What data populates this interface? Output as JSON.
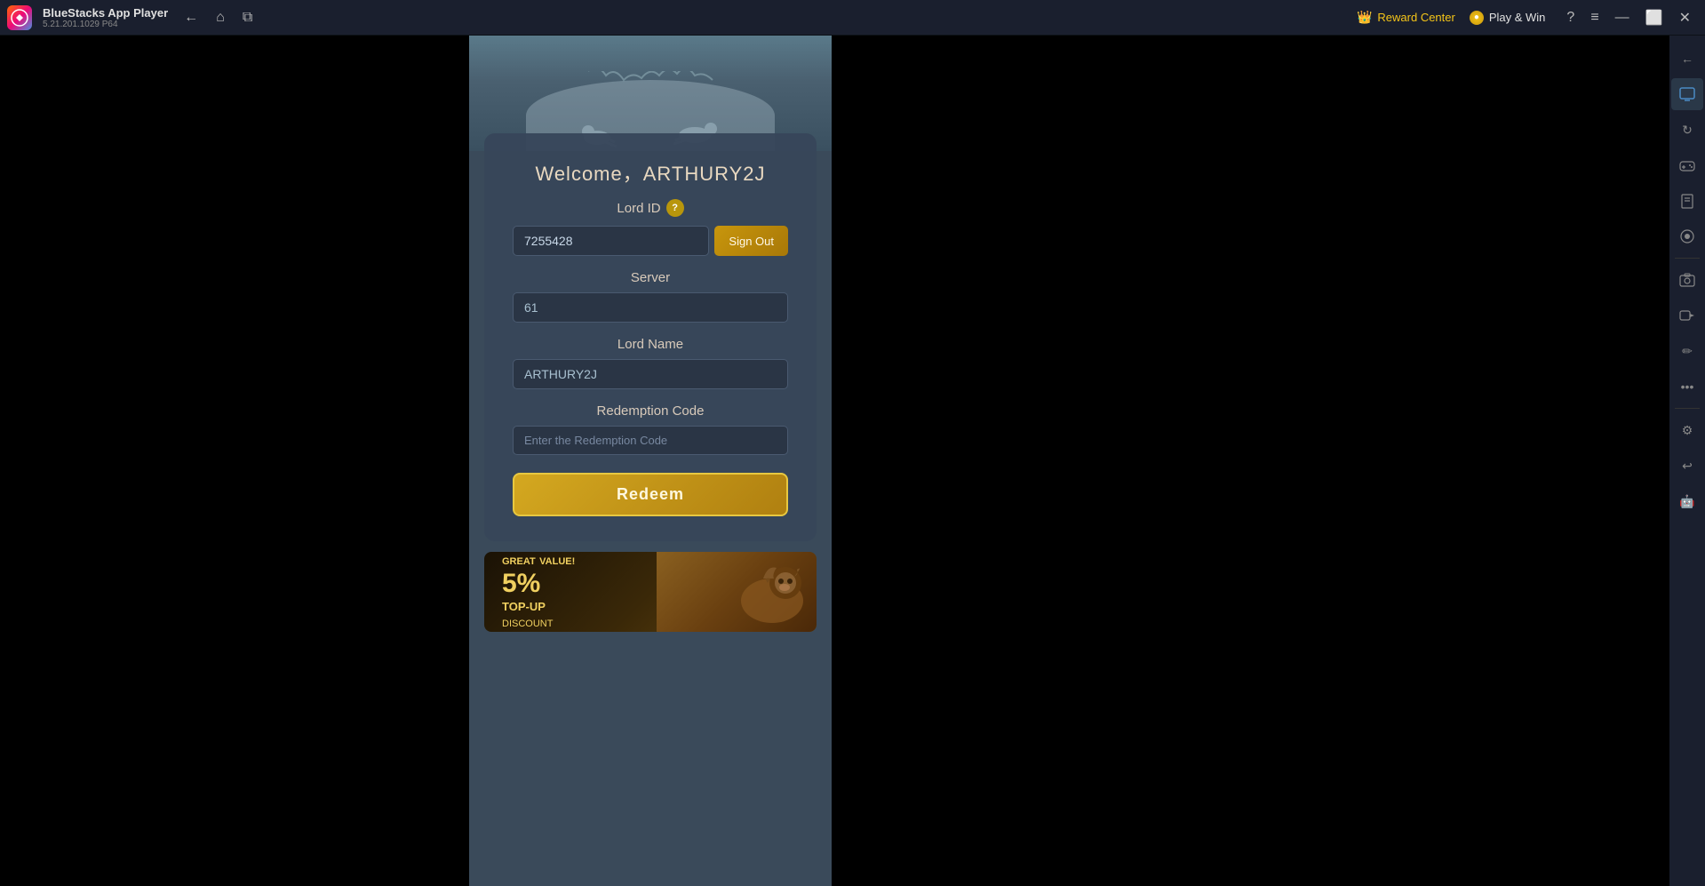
{
  "titlebar": {
    "logo_text": "B",
    "app_name": "BlueStacks App Player",
    "app_version": "5.21.201.1029  P64",
    "nav": {
      "back_label": "←",
      "home_label": "⌂",
      "multi_label": "⧉"
    },
    "reward_center": "Reward Center",
    "play_win": "Play & Win",
    "help_label": "?",
    "menu_label": "≡",
    "minimize_label": "—",
    "maximize_label": "⬜",
    "close_label": "✕"
  },
  "game": {
    "welcome_text": "Welcome，ARTHURY2J",
    "lord_id_label": "Lord ID",
    "lord_id_value": "7255428",
    "sign_out_label": "Sign Out",
    "server_label": "Server",
    "server_value": "61",
    "lord_name_label": "Lord Name",
    "lord_name_value": "ARTHURY2J",
    "redemption_code_label": "Redemption Code",
    "redemption_code_placeholder": "Enter the Redemption Code",
    "redeem_label": "Redeem"
  },
  "banner": {
    "great_value": "GREAT",
    "great_suffix": "VALUE!",
    "percent": "5%",
    "topup": "TOP-UP",
    "discount": "DISCOUNT"
  },
  "sidebar": {
    "icons": [
      {
        "name": "settings-icon",
        "symbol": "⚙"
      },
      {
        "name": "display-icon",
        "symbol": "🖥"
      },
      {
        "name": "rotate-icon",
        "symbol": "↻"
      },
      {
        "name": "gamepad-icon",
        "symbol": "🎮"
      },
      {
        "name": "apk-icon",
        "symbol": "📦"
      },
      {
        "name": "macro-icon",
        "symbol": "⏺"
      },
      {
        "name": "screenshot-icon",
        "symbol": "📷"
      },
      {
        "name": "video-icon",
        "symbol": "▶"
      },
      {
        "name": "edit-icon",
        "symbol": "✏"
      },
      {
        "name": "more-icon",
        "symbol": "…"
      },
      {
        "name": "config-icon",
        "symbol": "⚙"
      },
      {
        "name": "back-icon",
        "symbol": "↩"
      },
      {
        "name": "android-icon",
        "symbol": "🤖"
      }
    ]
  }
}
